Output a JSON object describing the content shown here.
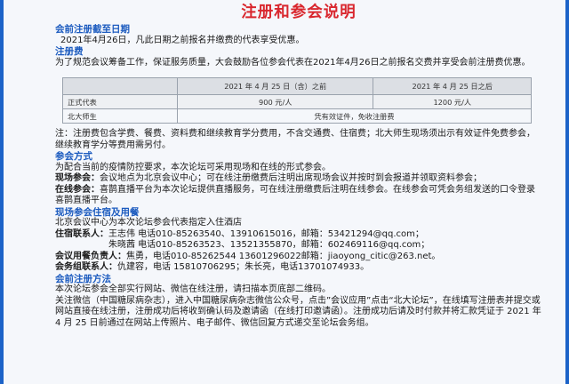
{
  "title": "注册和参会说明",
  "deadline": {
    "heading": "会前注册截至日期",
    "text": "2021年4月26日，凡此日期之前报名并缴费的代表享受优惠。"
  },
  "fee": {
    "heading": "注册费",
    "text": "为了规范会议筹备工作，保证服务质量，大会鼓励各位参会代表在2021年4月26日之前报名交费并享受会前注册费优惠。"
  },
  "fee_table": {
    "header": [
      "",
      "2021 年 4 月 25 日（含）之前",
      "2021 年 4 月 25 日之后"
    ],
    "rows": [
      {
        "label": "正式代表",
        "before": "900 元/人",
        "after": "1200 元/人"
      },
      {
        "label": "北大师生",
        "merged": "凭有效证件，免收注册费"
      }
    ]
  },
  "note": "注：注册费包含学费、餐费、资料费和继续教育学分费用，不含交通费、住宿费；北大师生现场须出示有效证件免费参会，继续教育学分等费用需另付。",
  "method": {
    "heading": "参会方式",
    "intro": "为配合当前的疫情防控要求，本次论坛可采用现场和在线的形式参会。",
    "onsite_label": "现场参会：",
    "onsite_text": "会议地点为北京会议中心；可在线注册缴费后注明出席现场会议并按时到会报道并领取资料参会；",
    "online_label": "在线参会：",
    "online_text": "喜鹊直播平台为本次论坛提供直播服务，可在线注册缴费后注明在线参会。在线参会可凭会务组发送的口令登录喜鹊直播平台。"
  },
  "hotel": {
    "heading": "现场参会住宿及用餐",
    "intro": "北京会议中心为本次论坛参会代表指定入住酒店",
    "stay_label": "住宿联系人：",
    "stay_1": "王志伟 电话010-85263540、13910615016，邮箱：53421294@qq.com；",
    "stay_2": "朱晓茜 电话010-85263523、13521355870，邮箱：602469116@qq.com；",
    "meal_label": "会议用餐负责人：",
    "meal_text": "焦勇，电话010-85262544 13601296022邮箱：jiaoyong_citic@263.net。",
    "staff_label": "会务组联系人：",
    "staff_text": "仇建容，电话 15810706295；朱长亮，电话13701074933。"
  },
  "register": {
    "heading": "会前注册方法",
    "line1": "本次论坛参会全部实行网站、微信在线注册，请扫描本页底部二维码。",
    "line2": "关注微信（中国糖尿病杂志），进入中国糖尿病杂志微信公众号，点击”会议应用”点击“北大论坛”，在线填写注册表并提交或网站直接在线注册，注册成功后将收到确认码及邀请函（在线打印邀请函）。注册成功后请及时付款并将汇款凭证于 2021 年 4 月 25 日前通过在网站上传照片、电子邮件、微信回复方式递交至论坛会务组。"
  },
  "colors": {
    "title": "#d9272e",
    "heading": "#1c5bbf",
    "accent_bar": "#1c63c8"
  }
}
